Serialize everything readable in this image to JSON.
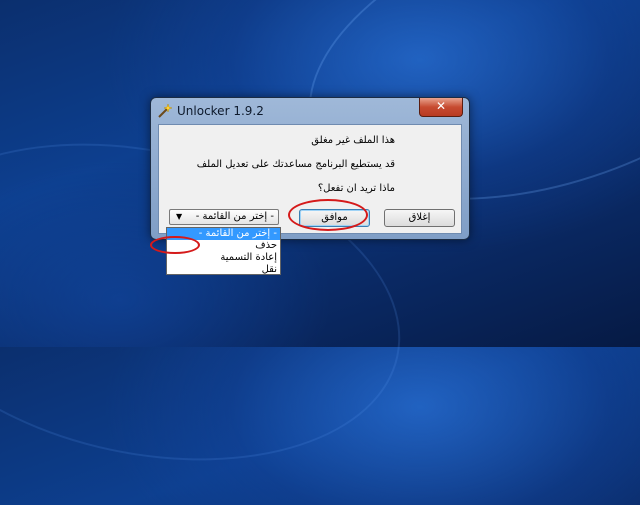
{
  "window": {
    "title": "Unlocker 1.9.2",
    "close_label": "✕"
  },
  "messages": {
    "line1": "هذا الملف غير مغلق",
    "line2": "قد يستطيع البرنامج مساعدتك على تعديل الملف",
    "line3": "ماذا تريد ان تفعل؟"
  },
  "action_select": {
    "value": "- إختر من القائمة -"
  },
  "buttons": {
    "ok": "موافق",
    "close": "إغلاق"
  },
  "dropdown": {
    "items": [
      "- إختر من القائمة -",
      "حذف",
      "إعادة التسمية",
      "نقل"
    ]
  },
  "colors": {
    "highlight": "#3399ff",
    "annotation_red": "#d51a1a"
  }
}
